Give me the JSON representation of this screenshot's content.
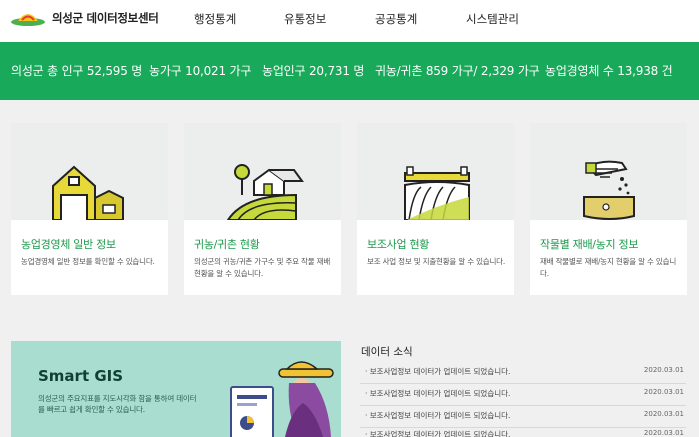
{
  "header": {
    "logo_text": "의성군 데이터정보센터",
    "nav": [
      "행정통계",
      "유통정보",
      "공공통계",
      "시스템관리"
    ]
  },
  "stats": [
    "의성군 총 인구 52,595 명",
    "농가구 10,021 가구",
    "농업인구 20,731 명",
    "귀농/귀촌 859 가구/ 2,329 가구",
    "농업경영체 수 13,938 건"
  ],
  "cards": [
    {
      "title": "농업경영체 일반 정보",
      "desc": "농업경영체 일반 정보를 확인할 수 있습니다.",
      "icon": "barn-icon"
    },
    {
      "title": "귀농/귀촌 현황",
      "desc": "의성군의 귀농/귀촌 가구수 및 주요 작물 재배 현황을 알 수 있습니다.",
      "icon": "house-field-icon"
    },
    {
      "title": "보조사업 현황",
      "desc": "보조 사업 정보 및 지출현황을 알 수 있습니다.",
      "icon": "greenhouse-icon"
    },
    {
      "title": "작물별 재배/농지 정보",
      "desc": "재배 작물별로 재배/농지 현황을 알 수 있습니다.",
      "icon": "seed-hand-icon"
    }
  ],
  "gis": {
    "title": "Smart GIS",
    "desc": "의성군의 주요지표를 지도시각화 함을 통하여 데이터를 빠르고 쉽게 확인할 수 있습니다."
  },
  "news": {
    "title": "데이터 소식",
    "items": [
      {
        "text": "· 보조사업정보 데이터가 업데이트 되었습니다.",
        "date": "2020.03.01"
      },
      {
        "text": "· 보조사업정보 데이터가 업데이트 되었습니다.",
        "date": "2020.03.01"
      },
      {
        "text": "· 보조사업정보 데이터가 업데이트 되었습니다.",
        "date": "2020.03.01"
      },
      {
        "text": "· 보조사업정보 데이터가 업데이트 되었습니다.",
        "date": "2020.03.01"
      }
    ]
  },
  "colors": {
    "brand_green": "#18a95a",
    "title_green": "#1e9a4d",
    "gis_bg": "#a8ddd0"
  }
}
